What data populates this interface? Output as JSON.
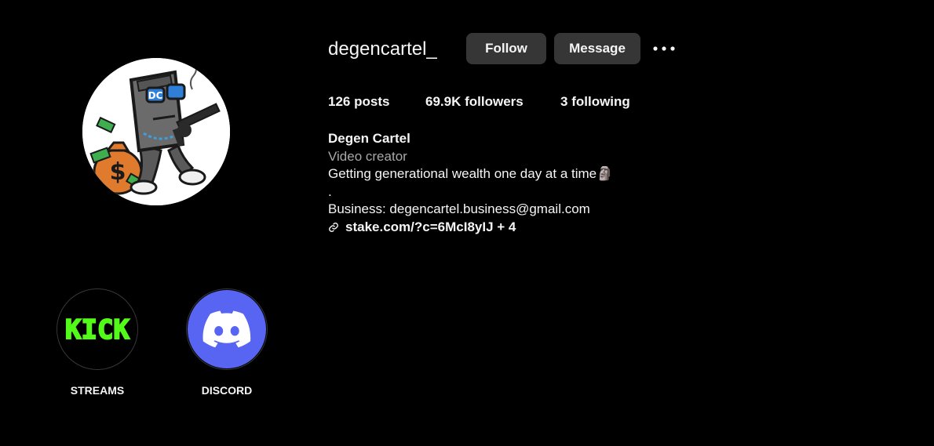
{
  "profile": {
    "username": "degencartel_",
    "avatar_icon": "moai-mascot-avatar-icon",
    "avatar_logo_text": "DC"
  },
  "actions": {
    "follow_label": "Follow",
    "message_label": "Message",
    "more_icon": "more-options-icon"
  },
  "stats": {
    "posts_count": "126",
    "posts_label": "posts",
    "followers_count": "69.9K",
    "followers_label": "followers",
    "following_count": "3",
    "following_label": "following"
  },
  "bio": {
    "display_name": "Degen Cartel",
    "category": "Video creator",
    "line1": "Getting generational wealth one day at a time🗿",
    "line2": ".",
    "line3": "Business: degencartel.business@gmail.com",
    "link_text": "stake.com/?c=6McI8yIJ + 4",
    "link_icon": "link-icon"
  },
  "highlights": [
    {
      "label": "STREAMS",
      "icon": "kick-logo-icon",
      "logo_text": "KICK",
      "color": "#53fc18"
    },
    {
      "label": "DISCORD",
      "icon": "discord-logo-icon",
      "color": "#5865f2"
    }
  ],
  "colors": {
    "background": "#000000",
    "button_bg": "#363636",
    "text": "#f5f5f5",
    "muted_text": "#a8a8a8"
  }
}
